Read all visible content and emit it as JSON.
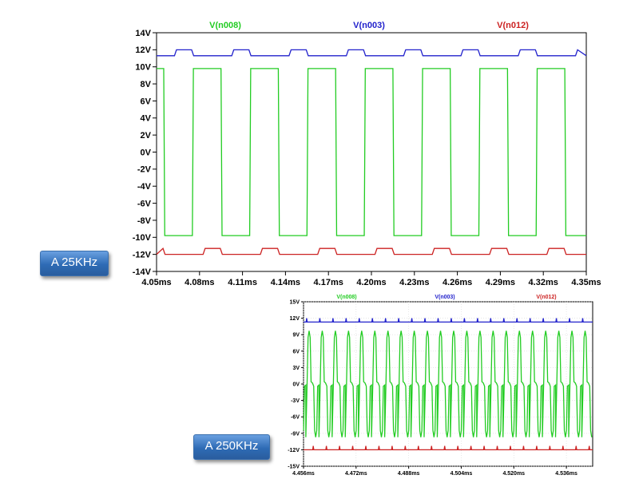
{
  "badges": {
    "freq_25k": "A 25KHz",
    "freq_250k": "A 250KHz"
  },
  "colors": {
    "green": "#22cc22",
    "blue": "#2222cc",
    "red": "#cc2222",
    "axis": "#000000",
    "grid": "#d8d8d8",
    "badge": "#3a78c4"
  },
  "chart_data": [
    {
      "type": "line",
      "title": "",
      "xlabel": "",
      "ylabel": "",
      "grid": false,
      "legend": "top",
      "xlim": [
        4.05,
        4.35
      ],
      "ylim": [
        -14,
        14
      ],
      "x_tick_labels": [
        "4.05ms",
        "4.08ms",
        "4.11ms",
        "4.14ms",
        "4.17ms",
        "4.20ms",
        "4.23ms",
        "4.26ms",
        "4.29ms",
        "4.32ms",
        "4.35ms"
      ],
      "x_tick_values": [
        4.05,
        4.08,
        4.11,
        4.14,
        4.17,
        4.2,
        4.23,
        4.26,
        4.29,
        4.32,
        4.35
      ],
      "y_tick_labels": [
        "14V",
        "12V",
        "10V",
        "8V",
        "6V",
        "4V",
        "2V",
        "0V",
        "-2V",
        "-4V",
        "-6V",
        "-8V",
        "-10V",
        "-12V",
        "-14V"
      ],
      "y_tick_values": [
        14,
        12,
        10,
        8,
        6,
        4,
        2,
        0,
        -2,
        -4,
        -6,
        -8,
        -10,
        -12,
        -14
      ],
      "series": [
        {
          "name": "V(n008)",
          "color": "#22cc22",
          "shape": "square",
          "period_ms": 0.04,
          "high": 9.8,
          "low": -9.8,
          "t0_ms": 4.055,
          "x_range": [
            4.05,
            4.35
          ]
        },
        {
          "name": "V(n003)",
          "color": "#2222cc",
          "shape": "pulse",
          "period_ms": 0.04,
          "high": 12.0,
          "low": 11.3,
          "t0_ms": 4.0625,
          "x_range": [
            4.05,
            4.35
          ]
        },
        {
          "name": "V(n012)",
          "color": "#cc2222",
          "shape": "pulse",
          "period_ms": 0.04,
          "high": -11.3,
          "low": -12.0,
          "t0_ms": 4.0825,
          "x_range": [
            4.05,
            4.35
          ]
        }
      ]
    },
    {
      "type": "line",
      "title": "",
      "xlabel": "",
      "ylabel": "",
      "grid": true,
      "legend": "top",
      "xlim": [
        4.456,
        4.544
      ],
      "ylim": [
        -15,
        15
      ],
      "x_tick_labels": [
        "4.456ms",
        "4.472ms",
        "4.488ms",
        "4.504ms",
        "4.520ms",
        "4.536ms"
      ],
      "x_tick_values": [
        4.456,
        4.472,
        4.488,
        4.504,
        4.52,
        4.536
      ],
      "y_tick_labels": [
        "15V",
        "12V",
        "9V",
        "6V",
        "3V",
        "0V",
        "-3V",
        "-6V",
        "-9V",
        "-12V",
        "-15V"
      ],
      "y_tick_values": [
        15,
        12,
        9,
        6,
        3,
        0,
        -3,
        -6,
        -9,
        -12,
        -15
      ],
      "series": [
        {
          "name": "V(n008)",
          "color": "#22cc22",
          "shape": "fast",
          "period_ms": 0.004,
          "high": 9.7,
          "low": -9.7,
          "t0_ms": 4.4567,
          "x_range": [
            4.456,
            4.544
          ]
        },
        {
          "name": "V(n003)",
          "color": "#2222cc",
          "shape": "spike",
          "period_ms": 0.004,
          "high": 12.0,
          "low": 11.3,
          "t0_ms": 4.4568,
          "x_range": [
            4.456,
            4.544
          ]
        },
        {
          "name": "V(n012)",
          "color": "#cc2222",
          "shape": "spike",
          "period_ms": 0.004,
          "high": -11.3,
          "low": -12.0,
          "t0_ms": 4.4588,
          "x_range": [
            4.456,
            4.544
          ]
        }
      ]
    }
  ]
}
